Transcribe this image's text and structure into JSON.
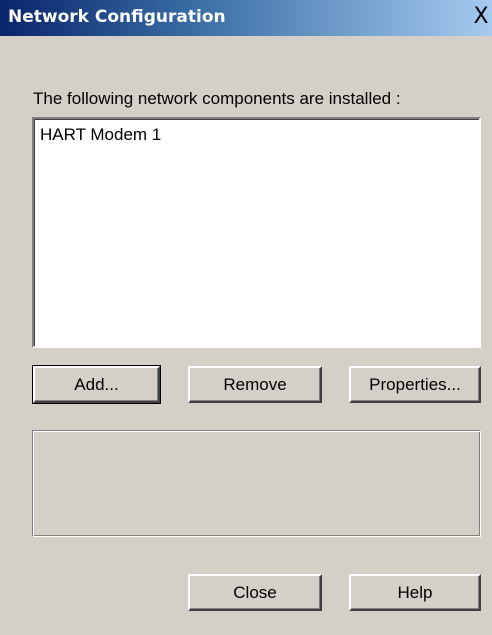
{
  "window": {
    "title": "Network Configuration",
    "close_glyph": "X"
  },
  "intro_label": "The following network components are installed :",
  "components": [
    "HART Modem 1"
  ],
  "buttons": {
    "add": "Add...",
    "remove": "Remove",
    "properties": "Properties...",
    "close": "Close",
    "help": "Help"
  },
  "description": ""
}
